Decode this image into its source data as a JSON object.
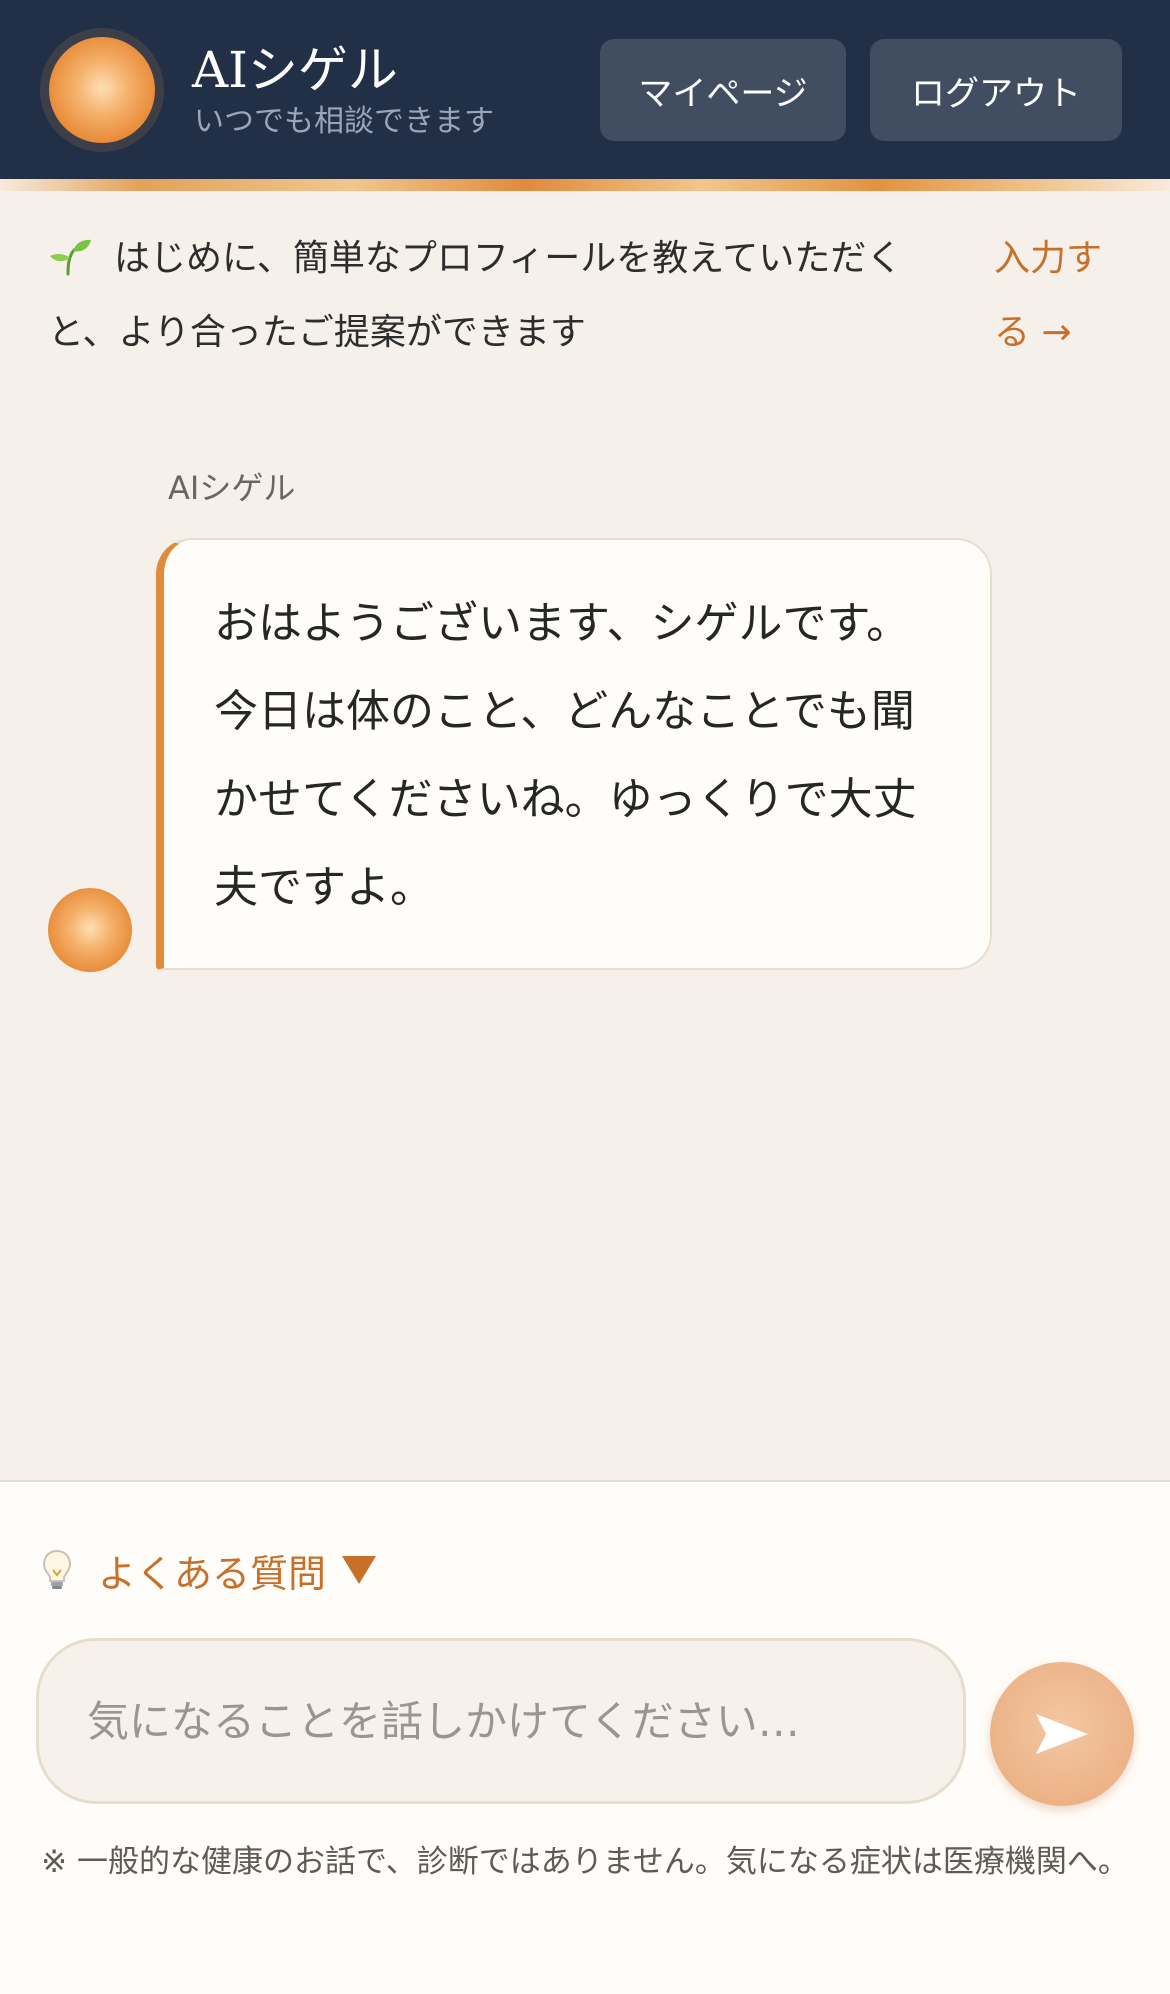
{
  "header": {
    "title": "AIシゲル",
    "subtitle": "いつでも相談できます",
    "mypage_label": "マイページ",
    "logout_label": "ログアウト"
  },
  "profile_notice": {
    "text": "はじめに、簡単なプロフィールを教えていただくと、より合ったご提案ができます",
    "link_label": "入力する →"
  },
  "chat": {
    "messages": [
      {
        "sender": "AIシゲル",
        "text": "おはようございます、シゲルです。今日は体のこと、どんなことでも聞かせてくださいね。ゆっくりで大丈夫ですよ。"
      }
    ]
  },
  "composer": {
    "faq_label": "よくある質問",
    "input_placeholder": "気になることを話しかけてください…",
    "disclaimer": "※ 一般的な健康のお話で、診断ではありません。気になる症状は医療機関へ。"
  },
  "colors": {
    "header_bg": "#213047",
    "accent": "#c8702a",
    "bubble_border": "#e08b3c",
    "page_bg": "#f5f1ea"
  },
  "icons": {
    "notice": "sprout-icon",
    "faq": "lightbulb-icon",
    "faq_toggle": "triangle-down-icon",
    "send": "send-arrow-icon"
  }
}
